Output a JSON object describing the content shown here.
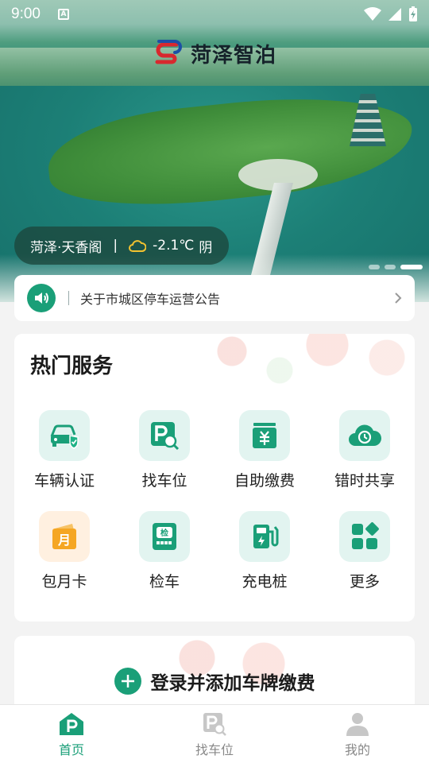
{
  "status_bar": {
    "time": "9:00",
    "notification_icon": "A"
  },
  "app": {
    "title": "菏泽智泊"
  },
  "banner": {
    "location": "菏泽·天香阁",
    "separator": "|",
    "temperature": "-2.1℃",
    "condition": "阴",
    "pages": 3,
    "active_page": 3
  },
  "notice": {
    "text": "关于市城区停车运营公告"
  },
  "services": {
    "title": "热门服务",
    "items": [
      {
        "label": "车辆认证",
        "icon": "car-verify-icon"
      },
      {
        "label": "找车位",
        "icon": "find-parking-icon"
      },
      {
        "label": "自助缴费",
        "icon": "self-pay-icon"
      },
      {
        "label": "错时共享",
        "icon": "time-share-icon"
      },
      {
        "label": "包月卡",
        "icon": "monthly-card-icon"
      },
      {
        "label": "检车",
        "icon": "vehicle-inspection-icon"
      },
      {
        "label": "充电桩",
        "icon": "charging-pile-icon"
      },
      {
        "label": "更多",
        "icon": "more-apps-icon"
      }
    ]
  },
  "login_card": {
    "text": "登录并添加车牌缴费"
  },
  "bottom_nav": {
    "items": [
      {
        "label": "首页",
        "icon": "home-parking-icon",
        "active": true
      },
      {
        "label": "找车位",
        "icon": "find-parking-icon",
        "active": false
      },
      {
        "label": "我的",
        "icon": "profile-icon",
        "active": false
      }
    ]
  },
  "colors": {
    "accent": "#1a9f78",
    "accent_light": "#e2f4f0",
    "orange": "#f5a623"
  }
}
